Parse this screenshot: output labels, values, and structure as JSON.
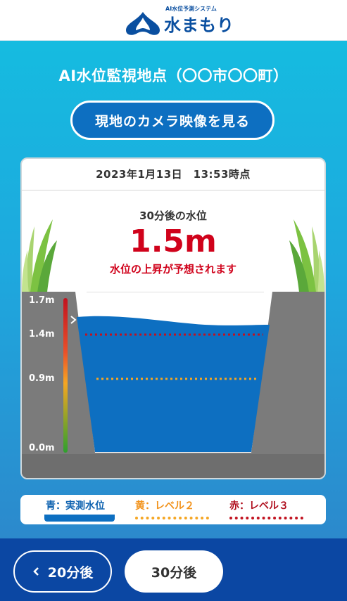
{
  "header": {
    "logo_small": "AI水位予測システム",
    "logo_text": "水まもり"
  },
  "site_title": "AI水位監視地点（〇〇市〇〇町）",
  "camera_button_label": "現地のカメラ映像を見る",
  "card": {
    "datetime": "2023年1月13日　13:53時点",
    "prediction_label": "30分後の水位",
    "prediction_value": "1.5m",
    "prediction_note": "水位の上昇が予想されます"
  },
  "gauge": {
    "labels": [
      "1.7m",
      "1.4m",
      "0.9m",
      "0.0m"
    ],
    "current_level_m": 1.5,
    "level2_m": 0.9,
    "level3_m": 1.4,
    "max_m": 1.7
  },
  "legend": {
    "blue": "青：実測水位",
    "yellow": "黄：レベル２",
    "red": "赤：レベル３"
  },
  "footer": {
    "prev_label": "20分後",
    "current_label": "30分後"
  },
  "colors": {
    "water": "#0d6fc1",
    "level2": "#f5a623",
    "level3": "#c1121f",
    "footer": "#0b47a3"
  }
}
